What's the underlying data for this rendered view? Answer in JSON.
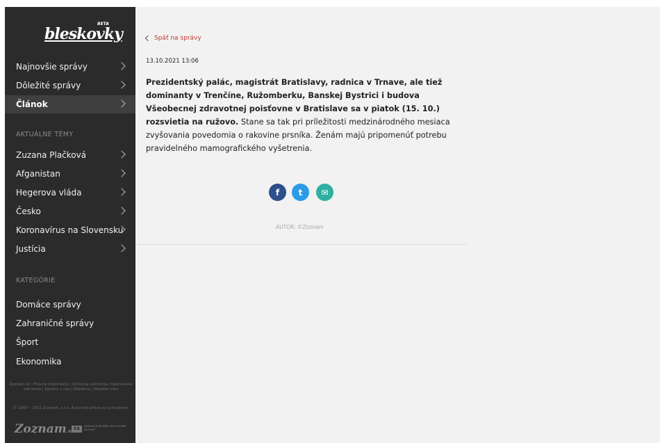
{
  "sidebar": {
    "logo": "bleskovky",
    "logo_badge": "BETA",
    "nav": [
      {
        "label": "Najnovšie správy"
      },
      {
        "label": "Dôležité správy"
      },
      {
        "label": "Článok"
      }
    ],
    "topics_heading": "AKTUÁLNE TÉMY",
    "topics": [
      {
        "label": "Zuzana Plačková"
      },
      {
        "label": "Afganistan"
      },
      {
        "label": "Hegerova vláda"
      },
      {
        "label": "Česko"
      },
      {
        "label": "Koronavírus na Slovensku"
      },
      {
        "label": "Justícia"
      }
    ],
    "categories_heading": "KATEGÓRIE",
    "categories": [
      {
        "label": "Domáce správy"
      },
      {
        "label": "Zahraničné správy"
      },
      {
        "label": "Šport"
      },
      {
        "label": "Ekonomika"
      }
    ],
    "footer_links": "Zoznam.sk | Právne informácie | Ochrana súkromia | Nastavenie súkromia | Kariéra u nás | Reklama | Napíšte nám",
    "footer_copy": "© 1997 – 2021 Zoznam, s.r.o. Autorské práva sú vyhradené.",
    "zoznam_logo": "Zoznam",
    "zoznam_logo_suffix": ".sk",
    "ea_badge": "EA",
    "ea_text": "NEZÁVISLÁ DRUŽBA STÁLE DOBRÉ ROZVIJAŤ"
  },
  "article": {
    "back_link": "Späť na správy",
    "date": "13.10.2021 13:06",
    "lead_bold": "Prezidentský palác, magistrát Bratislavy, radnica v Trnave, ale tiež dominanty v Trenčíne, Ružomberku, Banskej Bystrici i budova Všeobecnej zdravotnej poisťovne v Bratislave sa v piatok (15. 10.) rozsvietia na ružovo.",
    "lead_rest": " Stane sa tak pri príležitosti medzinárodného mesiaca zvyšovania povedomia o rakovine prsníka. Ženám majú pripomenúť potrebu pravidelného mamografického vyšetrenia.",
    "share": {
      "facebook": "f",
      "twitter": "t",
      "email": "✉"
    },
    "author": "AUTOR: ©Zoznam"
  },
  "colors": {
    "sidebar_bg": "#2b2b2b",
    "accent_link": "#c0392b",
    "facebook": "#2e4f8b",
    "twitter": "#2b9be6",
    "email": "#2fb0a0"
  },
  "icons": {
    "nav_chevron": "chevron-right-icon",
    "back": "chevron-left-icon"
  }
}
